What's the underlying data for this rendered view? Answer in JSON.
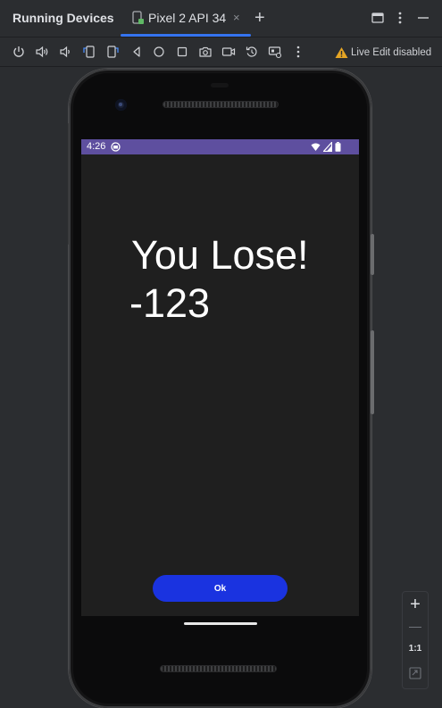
{
  "header": {
    "panel_title": "Running Devices",
    "tab_label": "Pixel 2 API 34",
    "tab_close": "×",
    "add_tab": "+"
  },
  "toolbar": {
    "icons": [
      "power-icon",
      "volume-up-icon",
      "volume-down-icon",
      "rotate-left-icon",
      "rotate-right-icon",
      "back-icon",
      "home-icon",
      "overview-icon",
      "camera-icon",
      "screen-record-icon",
      "undo-icon",
      "device-settings-icon",
      "more-icon"
    ],
    "live_edit_label": "Live Edit disabled"
  },
  "device": {
    "status_time": "4:26",
    "title": "You Lose!",
    "score": "-123",
    "ok_label": "Ok"
  },
  "zoom": {
    "zoom_in": "+",
    "actual_size": "1:1"
  },
  "colors": {
    "accent": "#3574f0",
    "status_bar": "#5e4f9f",
    "ok_button": "#1a33e0",
    "warning": "#e5a524"
  }
}
